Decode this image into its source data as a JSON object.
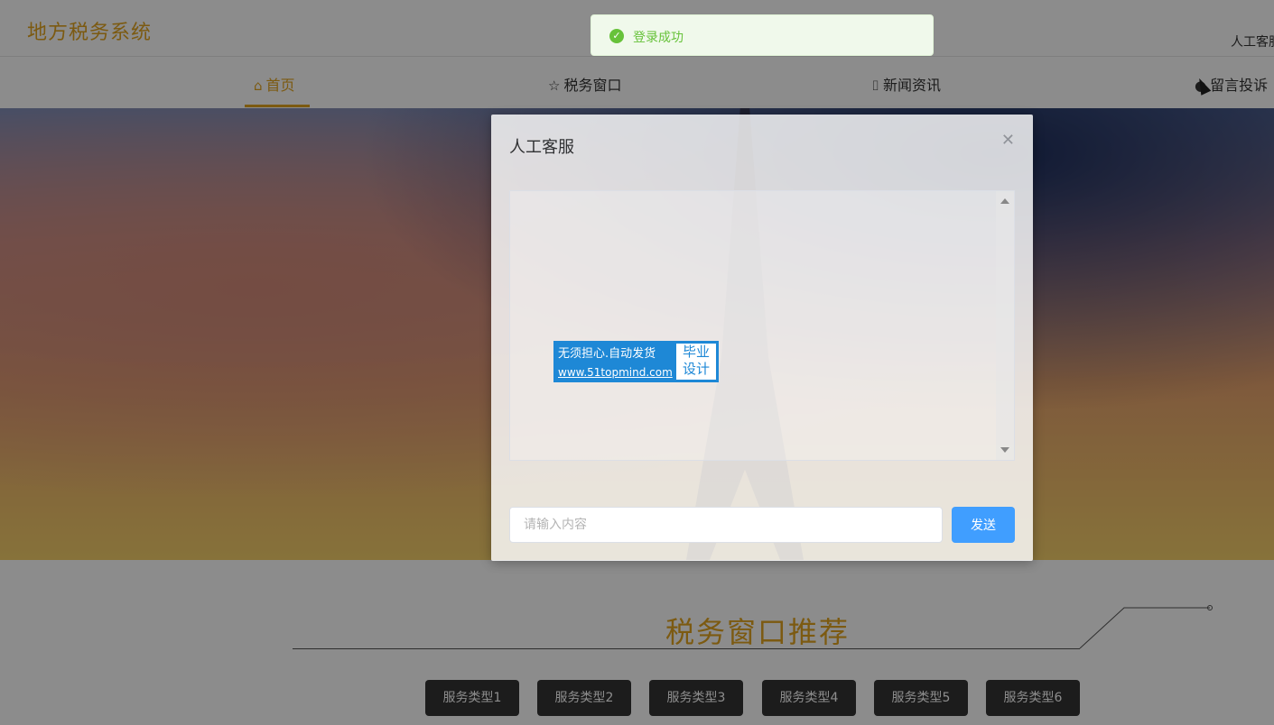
{
  "header": {
    "brand": "地方税务系统",
    "top_right_link": "人工客服"
  },
  "toast": {
    "message": "登录成功",
    "icon": "check-circle-icon",
    "color": "#67c23a"
  },
  "nav": {
    "items": [
      {
        "label": "首页",
        "icon": "home-icon",
        "active": true
      },
      {
        "label": "税务窗口",
        "icon": "star-icon",
        "active": false
      },
      {
        "label": "新闻资讯",
        "icon": "bag-icon",
        "active": false
      },
      {
        "label": "留言投诉",
        "icon": "location-icon",
        "active": false
      }
    ],
    "accent_color": "#e2a41f"
  },
  "section": {
    "title": "税务窗口推荐",
    "service_buttons": [
      "服务类型1",
      "服务类型2",
      "服务类型3",
      "服务类型4",
      "服务类型5",
      "服务类型6"
    ]
  },
  "dialog": {
    "title": "人工客服",
    "close_icon": "close-icon",
    "input_placeholder": "请输入内容",
    "send_label": "发送",
    "send_color": "#409eff"
  },
  "watermark": {
    "line1": "无须担心.自动发货",
    "line2": "www.51topmind.com",
    "badge": "毕业设计"
  }
}
